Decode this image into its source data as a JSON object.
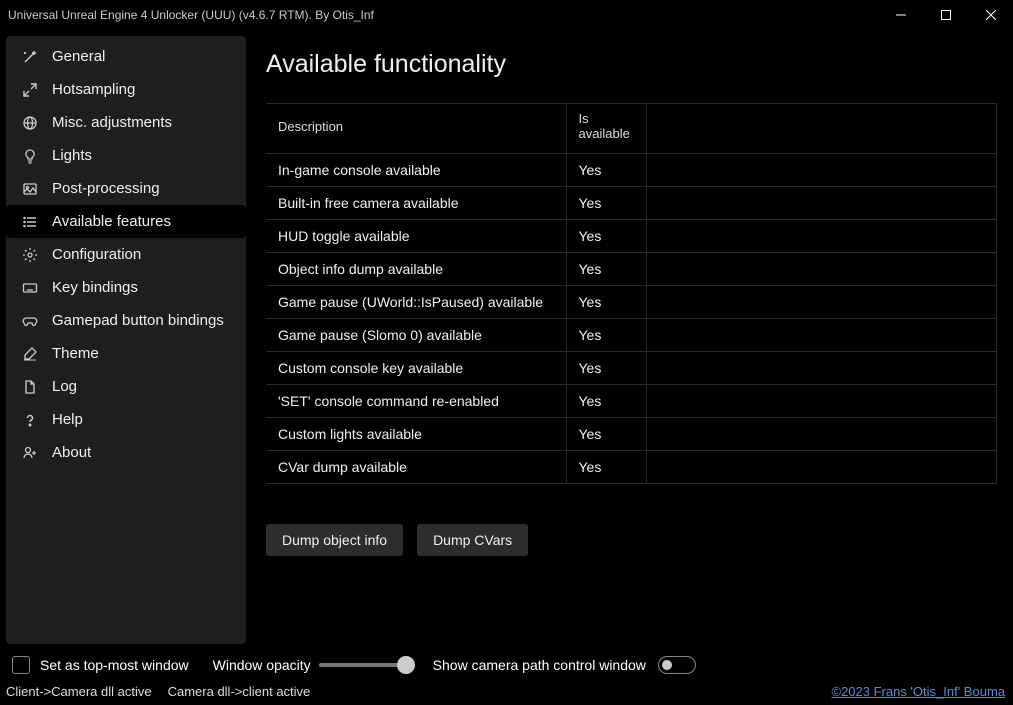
{
  "window": {
    "title": "Universal Unreal Engine 4 Unlocker (UUU) (v4.6.7 RTM). By Otis_Inf"
  },
  "sidebar": {
    "items": [
      {
        "label": "General",
        "icon": "wand"
      },
      {
        "label": "Hotsampling",
        "icon": "expand"
      },
      {
        "label": "Misc. adjustments",
        "icon": "globe"
      },
      {
        "label": "Lights",
        "icon": "bulb"
      },
      {
        "label": "Post-processing",
        "icon": "image"
      },
      {
        "label": "Available features",
        "icon": "list",
        "active": true
      },
      {
        "label": "Configuration",
        "icon": "gear"
      },
      {
        "label": "Key bindings",
        "icon": "keyboard"
      },
      {
        "label": "Gamepad button bindings",
        "icon": "gamepad"
      },
      {
        "label": "Theme",
        "icon": "palette"
      },
      {
        "label": "Log",
        "icon": "file"
      },
      {
        "label": "Help",
        "icon": "question"
      },
      {
        "label": "About",
        "icon": "person"
      }
    ]
  },
  "page": {
    "title": "Available functionality"
  },
  "table": {
    "headers": [
      "Description",
      "Is available",
      ""
    ],
    "rows": [
      {
        "desc": "In-game console available",
        "avail": "Yes"
      },
      {
        "desc": "Built-in free camera available",
        "avail": "Yes"
      },
      {
        "desc": "HUD toggle available",
        "avail": "Yes"
      },
      {
        "desc": "Object info dump available",
        "avail": "Yes"
      },
      {
        "desc": "Game pause (UWorld::IsPaused) available",
        "avail": "Yes"
      },
      {
        "desc": "Game pause (Slomo 0) available",
        "avail": "Yes"
      },
      {
        "desc": "Custom console key available",
        "avail": "Yes"
      },
      {
        "desc": "'SET' console command re-enabled",
        "avail": "Yes"
      },
      {
        "desc": "Custom lights available",
        "avail": "Yes"
      },
      {
        "desc": "CVar dump available",
        "avail": "Yes"
      }
    ]
  },
  "buttons": {
    "dump_object": "Dump object info",
    "dump_cvars": "Dump CVars"
  },
  "bottombar": {
    "topmost_label": "Set as top-most window",
    "opacity_label": "Window opacity",
    "camera_window_label": "Show camera path control window"
  },
  "status": {
    "client": "Client->Camera dll active",
    "camera": "Camera dll->client active",
    "copyright": "©2023 Frans 'Otis_Inf' Bouma"
  }
}
